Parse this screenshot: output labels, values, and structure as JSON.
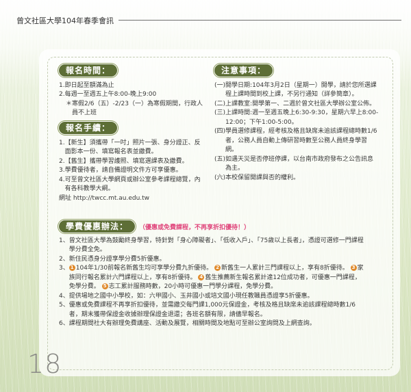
{
  "header": {
    "title": "曾文社區大學104年春季會訊"
  },
  "page_number": "18",
  "registration_time": {
    "title": "報名時間：",
    "items": [
      {
        "label": "1. ",
        "text": "即日起至額滿為止"
      },
      {
        "label": "2. ",
        "text": "每週一至週五上午8:00-晚上9:00"
      },
      {
        "label": "＊",
        "text": "寒假2/6（五）-2/23（一）為寒假期間，行政人員不上班"
      }
    ]
  },
  "registration_procedure": {
    "title": "報名手續：",
    "items": [
      {
        "label": "1. ",
        "text": "【新生】須攜帶「一吋」照片一張、身分證正、反面影本一份、填寫報名表並繳費。"
      },
      {
        "label": "2. ",
        "text": "【舊生】攜帶學習護照、填寫選課表及繳費。"
      },
      {
        "label": "3. ",
        "text": "學費優待者，請自備證明文件方可享優惠。"
      },
      {
        "label": "4. ",
        "text": "可至曾文社區大學網頁或辦公室參考課程總覽，內有各科教學大綱。"
      }
    ],
    "url_line": "網址 http://twcc.mt.au.edu.tw"
  },
  "notes": {
    "title": "注意事項：",
    "items": [
      {
        "label": "(一) ",
        "text": "開學日期:104年3月2日（星期一）開學，請於您所選課程上課時間到校上課，不另行通知（詳參簡章）。"
      },
      {
        "label": "(二) ",
        "text": "上課教室:開學第一、二週於曾文社區大學辦公室公佈。"
      },
      {
        "label": "(三) ",
        "text": "上課時間:週一至週五晚上6:30-9:30，星期六早上8:00-12:00；下午1:00-5:00。"
      },
      {
        "label": "(四) ",
        "text": "學員選修課程，經考核及格且缺席未逾該課程總時數1/6者，公務人員自動上傳研習時數至公務人員終身學習網。"
      },
      {
        "label": "(五) ",
        "text": "如遇天災是否停班停課，以台南市政府發布之公告訊息為主。"
      },
      {
        "label": "(六) ",
        "text": "本校保留開課與否的權利。"
      }
    ]
  },
  "discount": {
    "title": "學費優惠辦法：",
    "note": "（優惠或免費課程，不再享折扣優待！）",
    "items": [
      {
        "label": "1、",
        "text": "曾文社區大學為鼓勵終身學習，特針對「身心障礙者」、「低收入戶」、「75歲以上長者」，憑證可選修一門課程學分費全免。"
      },
      {
        "label": "2、",
        "text": "新住民憑身分證享學分費5折優惠。"
      },
      {
        "label": "3、",
        "parts": [
          {
            "n": "1",
            "t": "104年1/30前報名新舊生均可享學分費九折優待。"
          },
          {
            "n": "2",
            "t": "新舊生一人累計三門課程以上，享有8折優待。"
          },
          {
            "n": "3",
            "t": "家族同行報名累計六門課程以上，享有8折優待。"
          },
          {
            "n": "4",
            "t": "舊生推薦新生報名累計達12位成功者，可優惠一門課程，免學分費。"
          },
          {
            "n": "5",
            "t": "志工累計服務時數，20小時可優惠一門學分課程，免學分費。"
          }
        ]
      },
      {
        "label": "4、",
        "text": "提供場地之國中小學校，如：六甲國小、玉井國小或培文國小現任教職員憑證享5折優惠。"
      },
      {
        "label": "5、",
        "text": "優惠或免費課程不再享折扣優待，並需繳交每門課1,000元保證金，考核及格且缺席未逾該課程總時數1/6者，期末獲帶保證金收據辦理保證金退還；各班名額有限，請儘早報名。"
      },
      {
        "label": "6、",
        "text": "課程期間社大有辦理免費講座、活動及展覽，相關時間及地點可至辦公室詢問及上網查詢。"
      }
    ]
  }
}
